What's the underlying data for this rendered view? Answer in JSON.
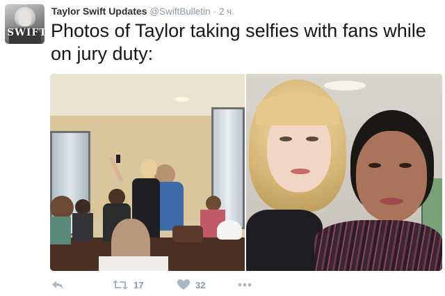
{
  "tweet": {
    "author": {
      "display_name": "Taylor Swift Updates",
      "handle": "@SwiftBulletin",
      "separator": "·",
      "time": "2 ч.",
      "avatar_logo_text": "SWIFT"
    },
    "text": "Photos of Taylor taking selfies with fans while on jury duty:",
    "media": {
      "photos": [
        {
          "name": "group-selfie-photo"
        },
        {
          "name": "close-up-selfie-photo"
        }
      ]
    },
    "actions": {
      "reply": {
        "icon": "reply-icon"
      },
      "retweet": {
        "icon": "retweet-icon",
        "count": "17"
      },
      "like": {
        "icon": "heart-icon",
        "count": "32"
      },
      "more": {
        "icon": "more-icon"
      }
    },
    "colors": {
      "name": "#292f33",
      "muted": "#8899a6",
      "icon": "#aab8c2"
    }
  }
}
